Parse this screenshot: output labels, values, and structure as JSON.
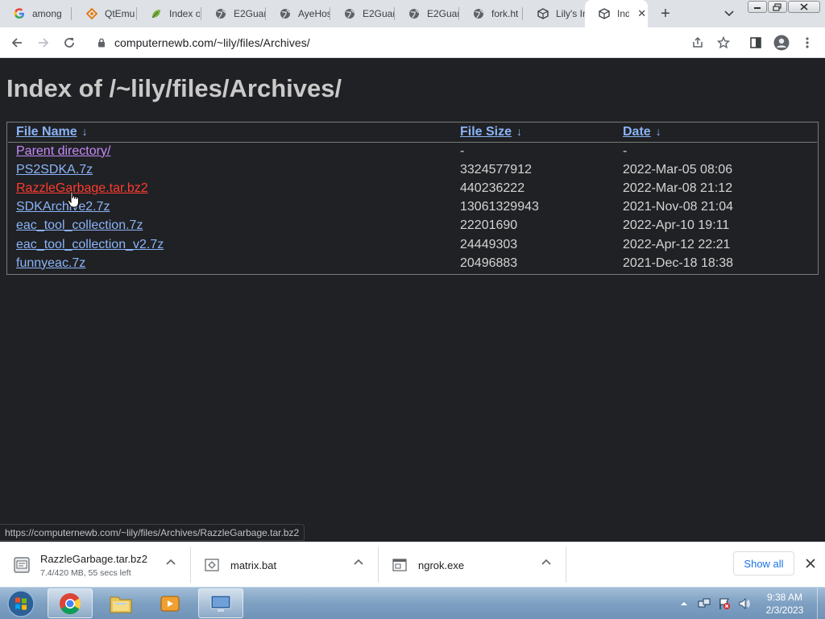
{
  "tabs": [
    {
      "title": "among",
      "icon": "google-icon"
    },
    {
      "title": "QtEmu",
      "icon": "qtemu-icon"
    },
    {
      "title": "Index o",
      "icon": "leaf-icon"
    },
    {
      "title": "E2Guar",
      "icon": "globe-icon"
    },
    {
      "title": "AyeHos",
      "icon": "globe-icon"
    },
    {
      "title": "E2Guar",
      "icon": "globe-icon"
    },
    {
      "title": "E2Guar",
      "icon": "globe-icon"
    },
    {
      "title": "fork.ht",
      "icon": "globe-icon"
    },
    {
      "title": "Lily's In",
      "icon": "cube-icon"
    },
    {
      "title": "Ind",
      "icon": "cube-icon",
      "active": true
    }
  ],
  "toolbar": {
    "url": "computernewb.com/~lily/files/Archives/"
  },
  "page": {
    "title": "Index of /~lily/files/Archives/",
    "columns": {
      "name": "File Name",
      "size": "File Size",
      "date": "Date",
      "sort_arrow": "↓"
    },
    "rows": [
      {
        "name": "Parent directory/",
        "size": "-",
        "date": "-",
        "state": "visited"
      },
      {
        "name": "PS2SDKA.7z",
        "size": "3324577912",
        "date": "2022-Mar-05 08:06",
        "state": "link"
      },
      {
        "name": "RazzleGarbage.tar.bz2",
        "size": "440236222",
        "date": "2022-Mar-08 21:12",
        "state": "hover"
      },
      {
        "name": "SDKArchive2.7z",
        "size": "13061329943",
        "date": "2021-Nov-08 21:04",
        "state": "link"
      },
      {
        "name": "eac_tool_collection.7z",
        "size": "22201690",
        "date": "2022-Apr-10 19:11",
        "state": "link"
      },
      {
        "name": "eac_tool_collection_v2.7z",
        "size": "24449303",
        "date": "2022-Apr-12 22:21",
        "state": "link"
      },
      {
        "name": "funnyeac.7z",
        "size": "20496883",
        "date": "2021-Dec-18 18:38",
        "state": "link"
      }
    ],
    "status_url": "https://computernewb.com/~lily/files/Archives/RazzleGarbage.tar.bz2"
  },
  "downloads": [
    {
      "name": "RazzleGarbage.tar.bz2",
      "status": "7.4/420 MB, 55 secs left",
      "icon": "bz2-file-icon"
    },
    {
      "name": "matrix.bat",
      "status": "",
      "icon": "bat-file-icon"
    },
    {
      "name": "ngrok.exe",
      "status": "",
      "icon": "exe-file-icon"
    }
  ],
  "shelf": {
    "show_all": "Show all"
  },
  "taskbar": {
    "time": "9:38 AM",
    "date": "2/3/2023"
  },
  "colors": {
    "link": "#8ab4f8",
    "visited": "#c58af9",
    "hover": "#ff3b30",
    "page_bg": "#202124"
  }
}
